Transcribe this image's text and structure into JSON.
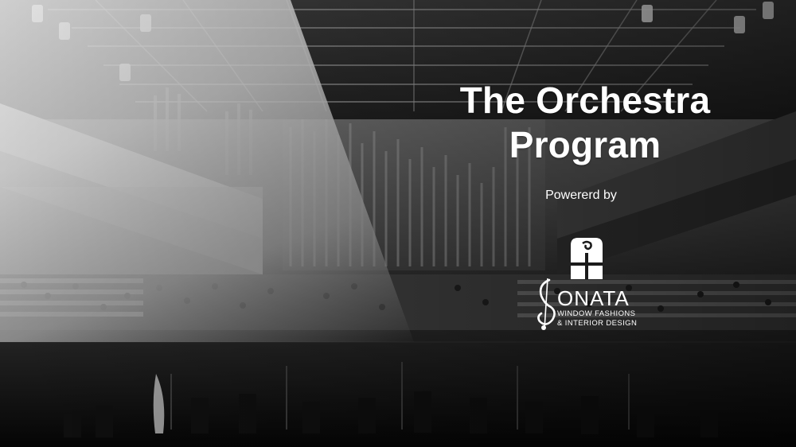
{
  "slide": {
    "title_line1": "The Orchestra",
    "title_line2": "Program",
    "powered_by": "Powererd by"
  },
  "brand": {
    "name": "ONATA",
    "tagline_line1": "WINDOW FASHIONS",
    "tagline_line2": "& INTERIOR DESIGN"
  },
  "colors": {
    "text": "#ffffff",
    "background_tone": "grayscale"
  },
  "icons": {
    "logo_mark": "window-icon",
    "brand_letter": "treble-clef-s-icon"
  }
}
